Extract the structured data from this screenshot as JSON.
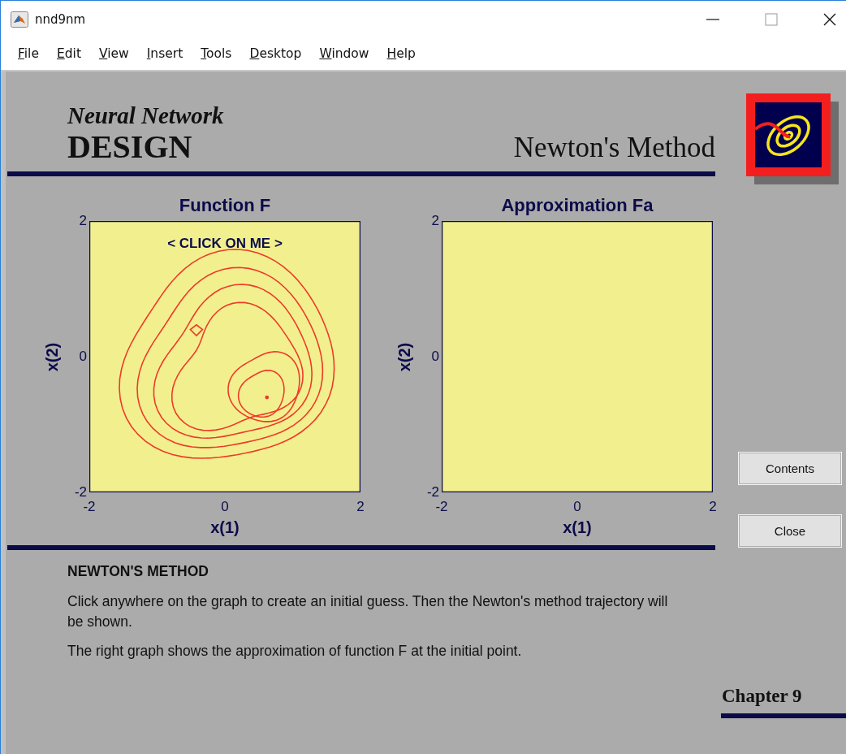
{
  "window": {
    "title": "nnd9nm"
  },
  "menu": [
    "File",
    "Edit",
    "View",
    "Insert",
    "Tools",
    "Desktop",
    "Window",
    "Help"
  ],
  "header": {
    "subtitle": "Neural Network",
    "title": "DESIGN",
    "topic": "Newton's Method"
  },
  "plots": [
    {
      "kind": "contour",
      "title": "Function F",
      "xlabel": "x(1)",
      "ylabel": "x(2)",
      "xticks": [
        "-2",
        "0",
        "2"
      ],
      "yticks": [
        "2",
        "0",
        "-2"
      ],
      "prompt": "< CLICK ON ME >"
    },
    {
      "kind": "empty",
      "title": "Approximation Fa",
      "xlabel": "x(1)",
      "ylabel": "x(2)",
      "xticks": [
        "-2",
        "0",
        "2"
      ],
      "yticks": [
        "2",
        "0",
        "-2"
      ]
    }
  ],
  "buttons": [
    "Contents",
    "Close"
  ],
  "description": {
    "heading": "NEWTON'S METHOD",
    "paragraphs": [
      "Click anywhere on the graph to create an initial guess. Then the Newton's method trajectory will be shown.",
      "The right graph shows the approximation of function F at the initial point."
    ]
  },
  "chapter": "Chapter 9"
}
